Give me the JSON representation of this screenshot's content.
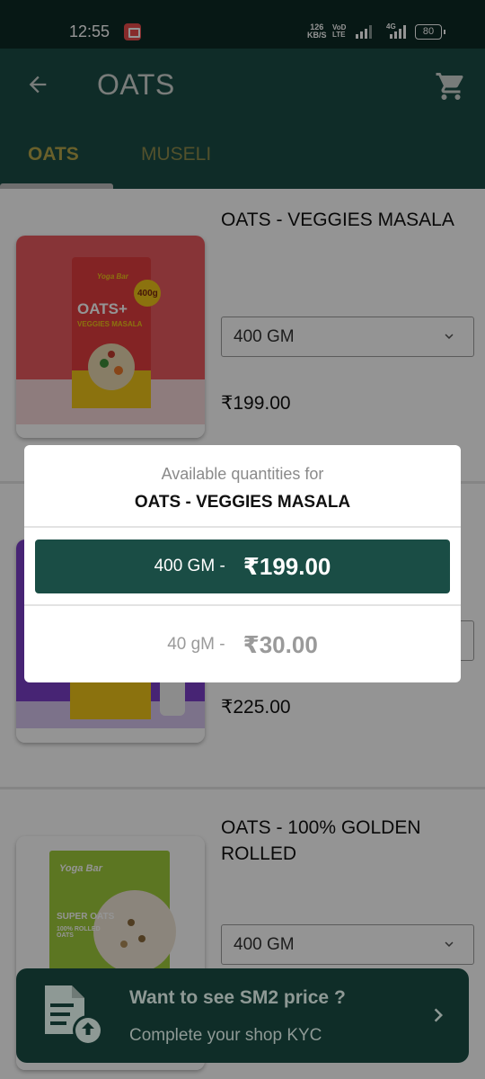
{
  "status_bar": {
    "time": "12:55",
    "net_speed_value": "126",
    "net_speed_unit": "KB/S",
    "volte_top": "VoD",
    "volte_bottom": "LTE",
    "network_type": "4G",
    "battery": "80"
  },
  "app_bar": {
    "title": "OATS",
    "back_icon": "back-arrow-icon",
    "cart_icon": "shopping-cart-icon"
  },
  "tabs": [
    {
      "label": "OATS",
      "active": true
    },
    {
      "label": "MUSELI",
      "active": false
    }
  ],
  "products": [
    {
      "name": "OATS - VEGGIES MASALA",
      "variant": "400 GM",
      "price": "₹199.00",
      "pack_brand": "Yoga Bar",
      "pack_title": "OATS+",
      "pack_subtitle": "VEGGIES MASALA",
      "pack_badge": "400g"
    },
    {
      "name": "",
      "variant": "",
      "price": "₹225.00"
    },
    {
      "name": "OATS - 100% GOLDEN ROLLED",
      "variant": "400 GM",
      "price": "",
      "pack_brand": "Yoga Bar",
      "pack_title": "SUPER OATS",
      "pack_subtitle": "100% ROLLED OATS"
    }
  ],
  "dialog": {
    "subtitle": "Available quantities for",
    "product_name": "OATS - VEGGIES MASALA",
    "options": [
      {
        "quantity": "400 GM",
        "price": "₹199.00",
        "selected": true
      },
      {
        "quantity": "40 gM",
        "price": "₹30.00",
        "selected": false
      }
    ]
  },
  "kyc_banner": {
    "heading": "Want to see SM2 price ?",
    "subtext": "Complete your shop KYC",
    "icon": "document-upload-icon",
    "arrow_icon": "chevron-right-icon"
  },
  "colors": {
    "primary": "#1a4d45",
    "tab_active": "#b6a64a",
    "status_bar": "#0d2a25"
  }
}
